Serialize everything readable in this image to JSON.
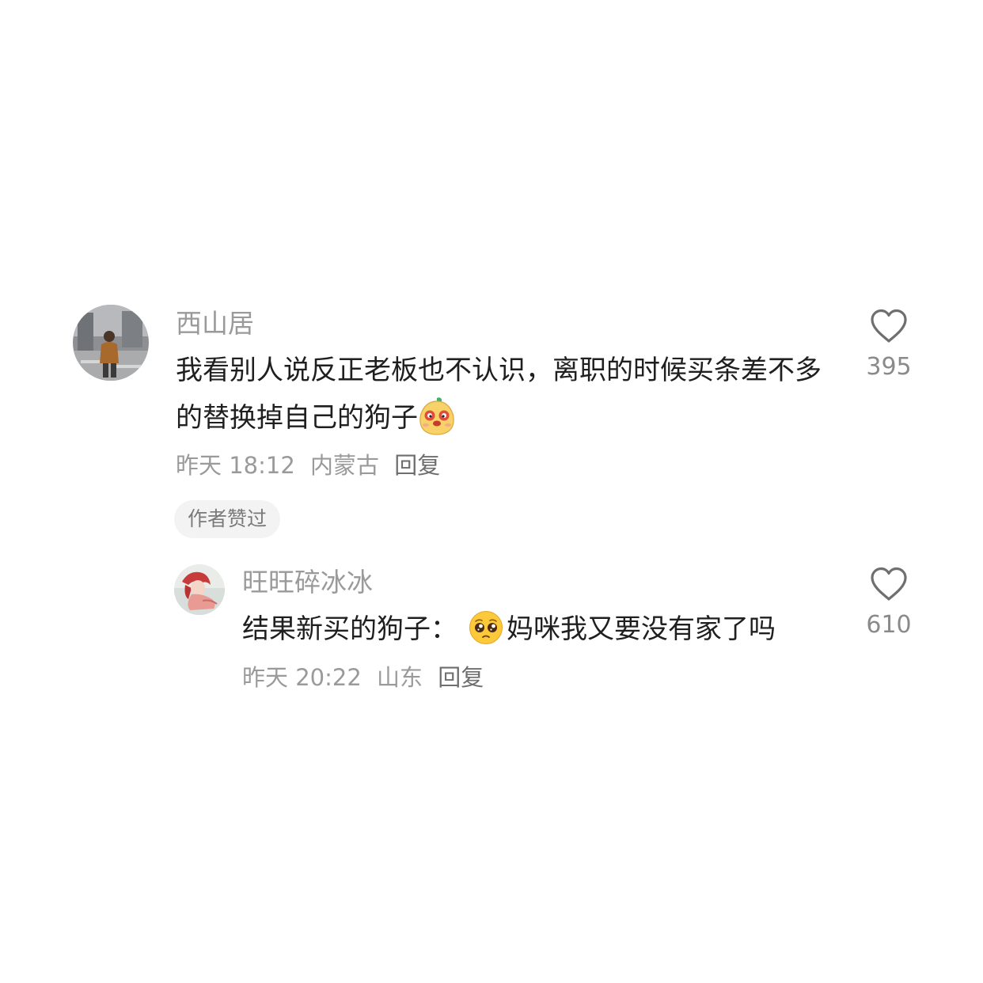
{
  "comments": [
    {
      "username": "西山居",
      "text_before_emoji": "我看别人说反正老板也不认识，离职的时候买条差不多的替换掉自己的狗子",
      "emoji": "sticker-emoji",
      "text_after_emoji": "",
      "meta": {
        "time": "昨天 18:12",
        "location": "内蒙古",
        "reply_label": "回复"
      },
      "badge": "作者赞过",
      "likes": "395"
    },
    {
      "username": "旺旺碎冰冰",
      "text_before_emoji": "结果新买的狗子：",
      "emoji": "pleading-face-emoji",
      "text_after_emoji": "妈咪我又要没有家了吗",
      "meta": {
        "time": "昨天 20:22",
        "location": "山东",
        "reply_label": "回复"
      },
      "likes": "610"
    }
  ],
  "colors": {
    "username": "#9a9a9a",
    "body_text": "#1f1f1f",
    "meta": "#9a9a9a",
    "badge_bg": "#f3f3f3",
    "like_count": "#8a8a8a"
  }
}
